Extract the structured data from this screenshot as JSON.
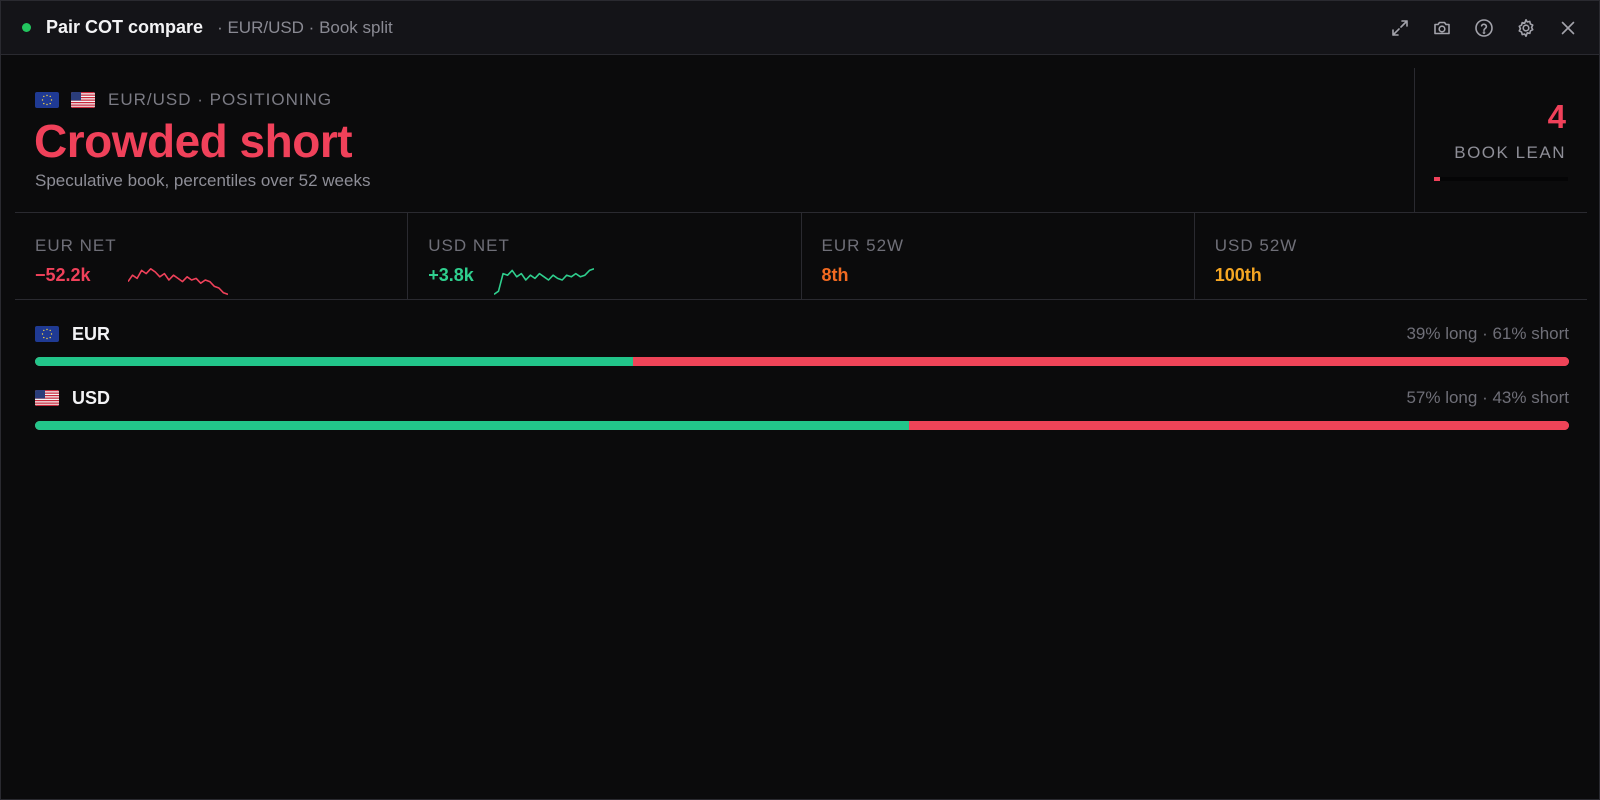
{
  "window": {
    "title": "Pair COT compare",
    "subtitle": "· EUR/USD · Book split",
    "status_color": "#22c55e",
    "toolbar": [
      {
        "icon": "expand-icon",
        "name": "expand-button"
      },
      {
        "icon": "camera-icon",
        "name": "screenshot-button"
      },
      {
        "icon": "help-icon",
        "name": "help-button"
      },
      {
        "icon": "gear-icon",
        "name": "settings-button"
      },
      {
        "icon": "close-icon",
        "name": "close-button"
      }
    ]
  },
  "header": {
    "flags": [
      "eu-flag-icon",
      "us-flag-icon"
    ],
    "pair_label": "EUR/USD · POSITIONING",
    "headline": "Crowded short",
    "headline_color": "#f0415a",
    "subline": "Speculative book, percentiles over 52 weeks"
  },
  "lean": {
    "value": "4",
    "label": "BOOK LEAN",
    "fraction": 0.04,
    "color": "#f0415a"
  },
  "stats": [
    {
      "label": "EUR NET",
      "value": "−52.2k",
      "color": "#f0415a",
      "sparkline": [
        0.55,
        0.35,
        0.45,
        0.2,
        0.3,
        0.15,
        0.25,
        0.4,
        0.3,
        0.5,
        0.35,
        0.45,
        0.55,
        0.4,
        0.5,
        0.45,
        0.6,
        0.5,
        0.55,
        0.7,
        0.75,
        0.9,
        0.95
      ]
    },
    {
      "label": "USD NET",
      "value": "+3.8k",
      "color": "#2fcf8e",
      "sparkline": [
        0.95,
        0.85,
        0.3,
        0.35,
        0.2,
        0.4,
        0.3,
        0.5,
        0.35,
        0.45,
        0.3,
        0.4,
        0.5,
        0.35,
        0.45,
        0.5,
        0.35,
        0.4,
        0.3,
        0.4,
        0.35,
        0.2,
        0.15
      ]
    },
    {
      "label": "EUR 52W",
      "value": "8th",
      "color": "#f26a21"
    },
    {
      "label": "USD 52W",
      "value": "100th",
      "color": "#f5a623"
    }
  ],
  "books": [
    {
      "code": "EUR",
      "flag": "eu-flag-icon",
      "split_text": "39% long · 61% short",
      "long_pct": 39,
      "short_pct": 61
    },
    {
      "code": "USD",
      "flag": "us-flag-icon",
      "split_text": "57% long · 43% short",
      "long_pct": 57,
      "short_pct": 43
    }
  ],
  "colors": {
    "long": "#22c58a",
    "short": "#ef4458",
    "background": "#0b0b0c"
  }
}
